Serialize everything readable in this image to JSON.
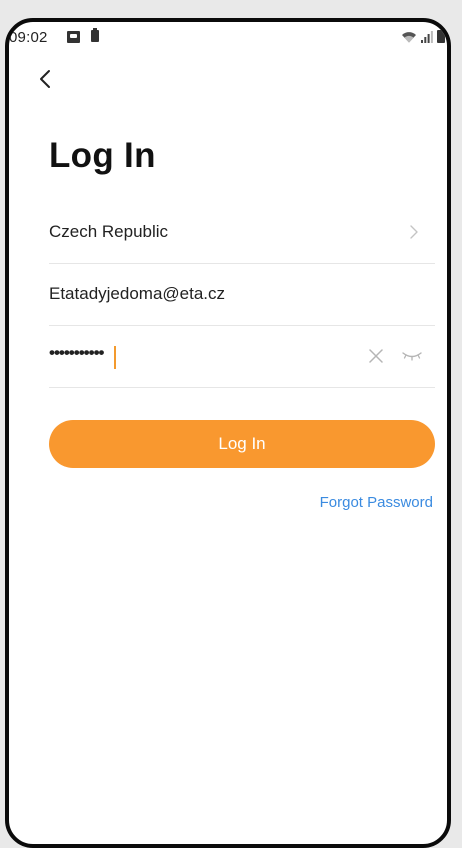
{
  "status_bar": {
    "time": "09:02",
    "icons": [
      "image-icon",
      "battery-saver-icon",
      "wifi-icon",
      "signal-icon",
      "battery-icon"
    ]
  },
  "header": {
    "back_icon": "chevron-left-icon"
  },
  "title": "Log In",
  "form": {
    "country": "Czech Republic",
    "email": "Etatadyjedoma@eta.cz",
    "password_masked": "•••••••••••",
    "actions": {
      "clear_icon": "close-icon",
      "visibility_icon": "eye-closed-icon"
    }
  },
  "login_button_label": "Log In",
  "forgot_password_label": "Forgot Password",
  "colors": {
    "accent": "#f9982f",
    "link": "#3b8be0",
    "text": "#222222",
    "divider": "#e6e6e6"
  }
}
